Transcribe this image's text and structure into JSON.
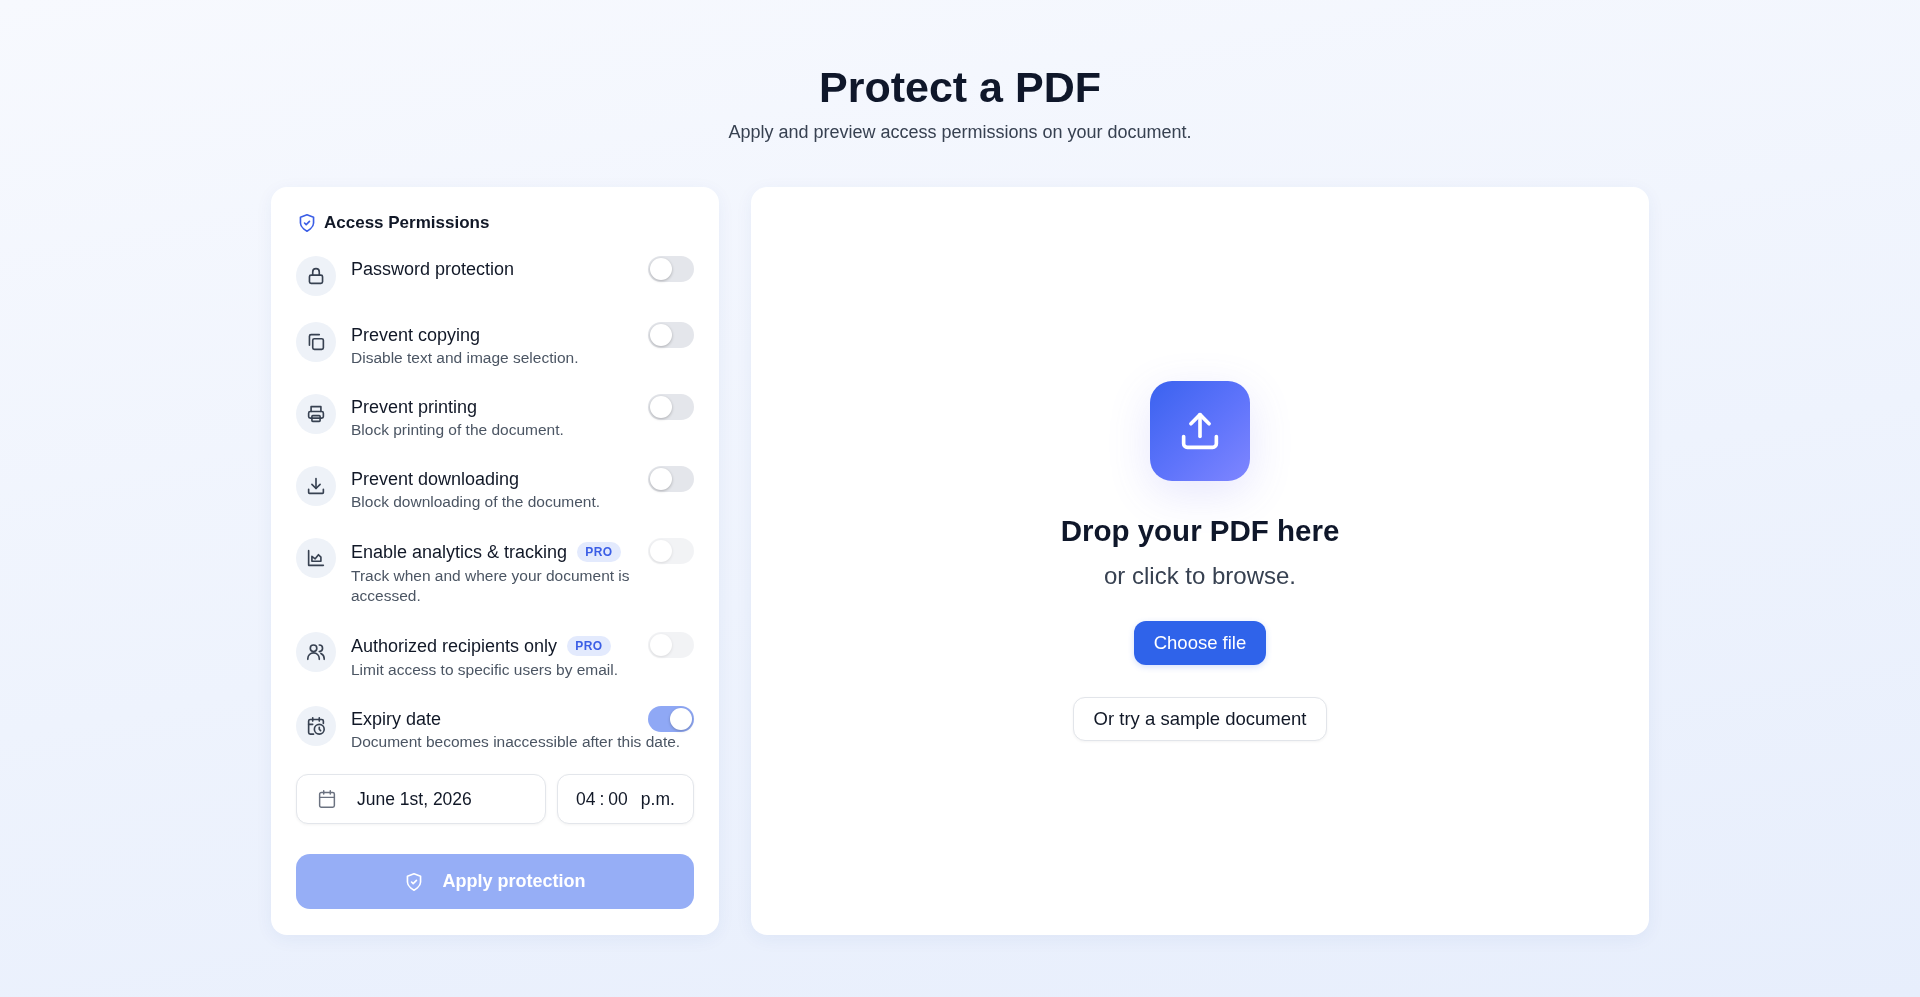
{
  "header": {
    "title": "Protect a PDF",
    "subtitle": "Apply and preview access permissions on your document."
  },
  "permissions_panel": {
    "title": "Access Permissions",
    "permissions": [
      {
        "label": "Password protection",
        "on": false,
        "disabled": false
      },
      {
        "label": "Prevent copying",
        "description": "Disable text and image selection.",
        "on": false,
        "disabled": false
      },
      {
        "label": "Prevent printing",
        "description": "Block printing of the document.",
        "on": false,
        "disabled": false
      },
      {
        "label": "Prevent downloading",
        "description": "Block downloading of the document.",
        "on": false,
        "disabled": false
      },
      {
        "label": "Enable analytics & tracking",
        "badge": "PRO",
        "description": "Track when and where your document is accessed.",
        "on": false,
        "disabled": true
      },
      {
        "label": "Authorized recipients only",
        "badge": "PRO",
        "description": "Limit access to specific users by email.",
        "on": false,
        "disabled": true
      },
      {
        "label": "Expiry date",
        "description": "Document becomes inaccessible after this date.",
        "on": true,
        "disabled": false
      }
    ],
    "date_field": {
      "value": "June 1st, 2026"
    },
    "time_field": {
      "hour": "04",
      "separator": ":",
      "minute": "00",
      "period": "p.m."
    },
    "apply_button": {
      "label": "Apply protection",
      "disabled": true
    }
  },
  "dropzone": {
    "title": "Drop your PDF here",
    "subtitle": "or click to browse.",
    "choose_button": {
      "label": "Choose file"
    },
    "sample_button": {
      "label": "Or try a sample document"
    }
  }
}
